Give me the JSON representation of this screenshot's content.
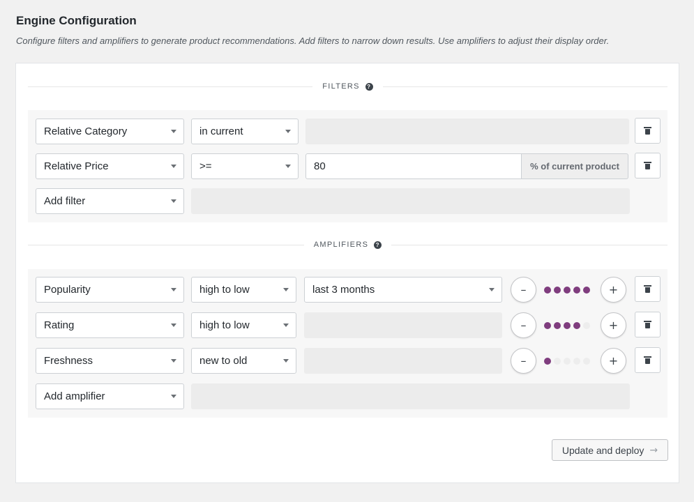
{
  "page": {
    "title": "Engine Configuration",
    "description": "Configure filters and amplifiers to generate product recommendations. Add filters to narrow down results. Use amplifiers to adjust their display order."
  },
  "filters": {
    "heading": "FILTERS",
    "help_icon": "?",
    "rows": [
      {
        "field": "Relative Category",
        "operator": "in current",
        "value": ""
      },
      {
        "field": "Relative Price",
        "operator": ">=",
        "value": "80",
        "suffix": "% of current product"
      }
    ],
    "add_label": "Add filter"
  },
  "amplifiers": {
    "heading": "AMPLIFIERS",
    "help_icon": "?",
    "rows": [
      {
        "field": "Popularity",
        "order": "high to low",
        "period": "last 3 months",
        "weight": 5,
        "max_weight": 5
      },
      {
        "field": "Rating",
        "order": "high to low",
        "period": "",
        "weight": 4,
        "max_weight": 5
      },
      {
        "field": "Freshness",
        "order": "new to old",
        "period": "",
        "weight": 1,
        "max_weight": 5
      }
    ],
    "add_label": "Add amplifier",
    "minus_symbol": "–",
    "plus_symbol": "+"
  },
  "actions": {
    "deploy_label": "Update and deploy",
    "deploy_arrow": "→"
  },
  "colors": {
    "accent": "#7f3d7e"
  },
  "icons": {
    "trash": "trash-icon",
    "help": "help-circle-icon",
    "arrow": "arrow-right-icon"
  }
}
